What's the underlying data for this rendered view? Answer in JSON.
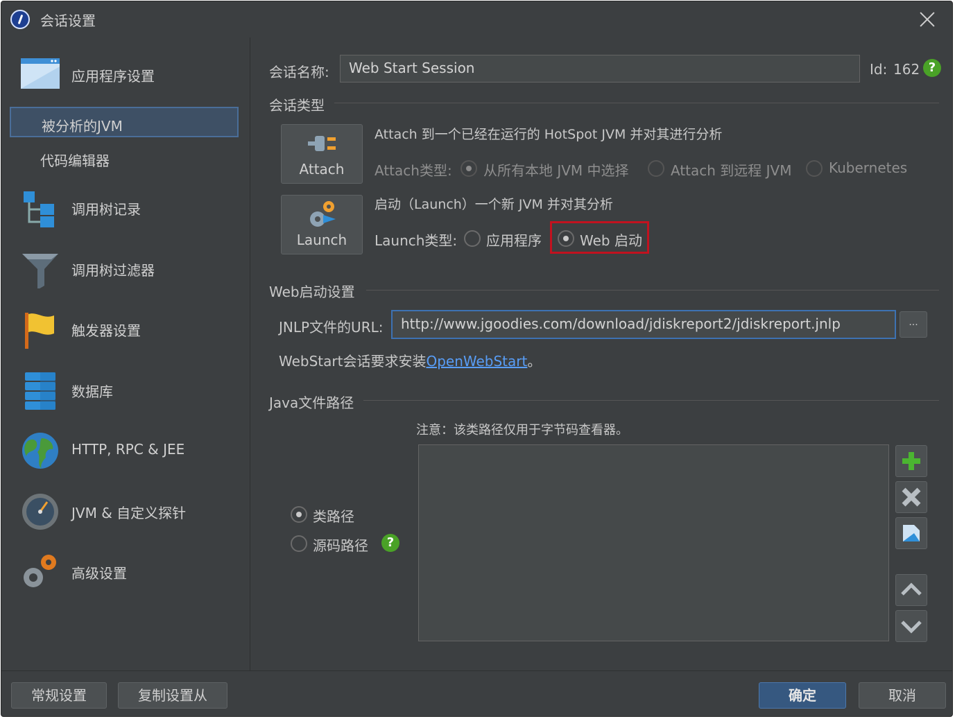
{
  "window": {
    "title": "会话设置"
  },
  "sidebar": {
    "items": [
      {
        "label": "应用程序设置",
        "icon": "app-window-icon"
      },
      {
        "label": "被分析的JVM",
        "selected": true
      },
      {
        "label": "代码编辑器"
      },
      {
        "label": "调用树记录",
        "icon": "call-tree-icon"
      },
      {
        "label": "调用树过滤器",
        "icon": "funnel-icon"
      },
      {
        "label": "触发器设置",
        "icon": "flag-icon"
      },
      {
        "label": "数据库",
        "icon": "database-icon"
      },
      {
        "label": "HTTP, RPC & JEE",
        "icon": "globe-icon"
      },
      {
        "label": "JVM & 自定义探针",
        "icon": "gauge-icon"
      },
      {
        "label": "高级设置",
        "icon": "gears-icon"
      }
    ]
  },
  "session": {
    "name_label": "会话名称:",
    "name_value": "Web Start Session",
    "id_label": "Id:",
    "id_value": "162",
    "type_heading": "会话类型"
  },
  "attach": {
    "button_label": "Attach",
    "description": "Attach 到一个已经在运行的 HotSpot JVM 并对其进行分析",
    "type_label": "Attach类型:",
    "options": [
      "从所有本地 JVM 中选择",
      "Attach 到远程 JVM",
      "Kubernetes"
    ]
  },
  "launch": {
    "button_label": "Launch",
    "description": "启动（Launch）一个新 JVM 并对其分析",
    "type_label": "Launch类型:",
    "options": [
      "应用程序",
      "Web 启动"
    ]
  },
  "web": {
    "heading": "Web启动设置",
    "url_label": "JNLP文件的URL:",
    "url_value": "http://www.jgoodies.com/download/jdiskreport2/jdiskreport.jnlp",
    "browse_label": "...",
    "note_prefix": "WebStart会话要求安装",
    "note_link": "OpenWebStart",
    "note_suffix": "。"
  },
  "java_path": {
    "heading": "Java文件路径",
    "note": "注意：该类路径仅用于字节码查看器。",
    "options": [
      "类路径",
      "源码路径"
    ]
  },
  "footer": {
    "general_button": "常规设置",
    "copy_button": "复制设置从",
    "ok_button": "确定",
    "cancel_button": "取消"
  },
  "colors": {
    "accent": "#3d72b3",
    "highlight": "#c1121f",
    "help": "#4aa227"
  }
}
